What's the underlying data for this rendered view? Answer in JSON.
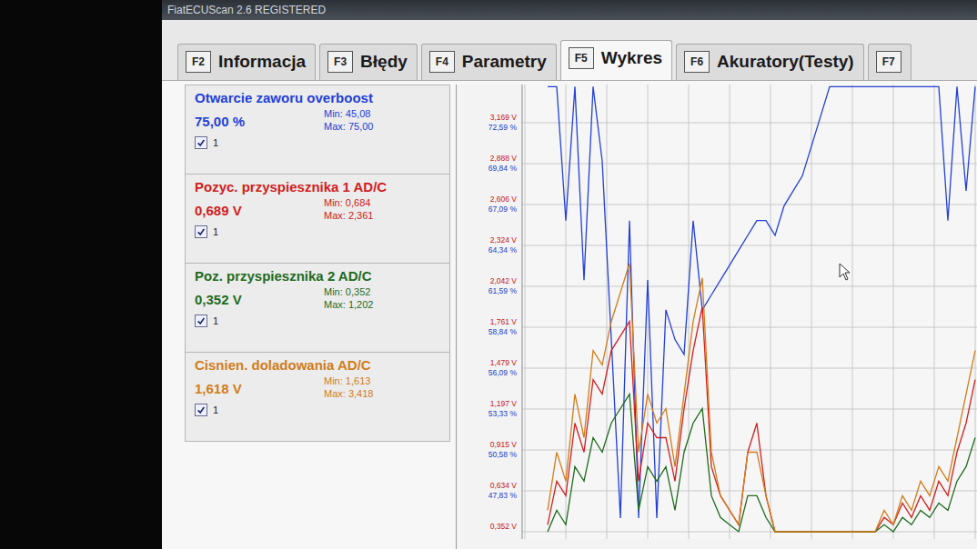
{
  "window": {
    "title": "FiatECUScan 2.6 REGISTERED"
  },
  "tabs": [
    {
      "key": "F2",
      "label": "Informacja",
      "selected": false
    },
    {
      "key": "F3",
      "label": "Błędy",
      "selected": false
    },
    {
      "key": "F4",
      "label": "Parametry",
      "selected": false
    },
    {
      "key": "F5",
      "label": "Wykres",
      "selected": true
    },
    {
      "key": "F6",
      "label": "Akuratory(Testy)",
      "selected": false
    },
    {
      "key": "F7",
      "label": "",
      "selected": false
    }
  ],
  "parameters": [
    {
      "name": "Otwarcie zaworu overboost",
      "value": "75,00 %",
      "min": "Min: 45,08",
      "max": "Max: 75,00",
      "checked": true,
      "channel": "1",
      "color": "#2340d8",
      "axis": "percent",
      "values": [
        75,
        75,
        66,
        75,
        62,
        75,
        70,
        58,
        46,
        66,
        46,
        62,
        46,
        60,
        58,
        57,
        66,
        60,
        61,
        62,
        63,
        64,
        65,
        66,
        66,
        65,
        67,
        68,
        69,
        71,
        73,
        75,
        75,
        75,
        75,
        75,
        75,
        75,
        75,
        75,
        75,
        75,
        75,
        75,
        66,
        75,
        68,
        75
      ]
    },
    {
      "name": "Pozyc. przyspiesznika 1 AD/C",
      "value": "0,689 V",
      "min": "Min: 0,684",
      "max": "Max: 2,361",
      "checked": true,
      "channel": "1",
      "color": "#d02020",
      "axis": "volts",
      "values": [
        0.4,
        0.7,
        0.6,
        1.1,
        0.9,
        1.4,
        1.3,
        1.6,
        1.7,
        1.8,
        0.7,
        1.1,
        1.0,
        1.0,
        0.7,
        1.2,
        1.6,
        1.9,
        0.8,
        0.6,
        0.5,
        0.4,
        0.9,
        1.1,
        0.6,
        0.352,
        0.352,
        0.352,
        0.352,
        0.352,
        0.352,
        0.352,
        0.352,
        0.352,
        0.352,
        0.352,
        0.352,
        0.45,
        0.4,
        0.55,
        0.45,
        0.6,
        0.5,
        0.7,
        0.6,
        0.9,
        1.1,
        1.4
      ]
    },
    {
      "name": "Poz. przyspiesznika 2 AD/C",
      "value": "0,352 V",
      "min": "Min: 0,352",
      "max": "Max: 1,202",
      "checked": true,
      "channel": "1",
      "color": "#1e6b1e",
      "axis": "volts",
      "values": [
        0.352,
        0.5,
        0.4,
        0.8,
        0.7,
        1.0,
        0.9,
        1.1,
        1.2,
        1.3,
        0.5,
        0.8,
        0.7,
        0.8,
        0.5,
        0.9,
        1.1,
        1.2,
        0.6,
        0.45,
        0.4,
        0.352,
        0.6,
        0.6,
        0.45,
        0.352,
        0.352,
        0.352,
        0.352,
        0.352,
        0.352,
        0.352,
        0.352,
        0.352,
        0.352,
        0.352,
        0.352,
        0.4,
        0.352,
        0.45,
        0.4,
        0.5,
        0.45,
        0.55,
        0.5,
        0.7,
        0.8,
        1.0
      ]
    },
    {
      "name": "Cisnien. doladowania AD/C",
      "value": "1,618 V",
      "min": "Min: 1,613",
      "max": "Max: 3,418",
      "checked": true,
      "channel": "1",
      "color": "#d07d1a",
      "axis": "volts",
      "values": [
        0.5,
        0.9,
        0.7,
        1.3,
        1.0,
        1.6,
        1.5,
        1.8,
        2.0,
        2.2,
        0.9,
        1.3,
        1.1,
        1.2,
        0.8,
        1.3,
        1.8,
        2.1,
        0.9,
        0.6,
        0.5,
        0.4,
        0.9,
        0.9,
        0.6,
        0.352,
        0.352,
        0.352,
        0.352,
        0.352,
        0.352,
        0.352,
        0.352,
        0.352,
        0.352,
        0.352,
        0.352,
        0.5,
        0.4,
        0.6,
        0.5,
        0.7,
        0.6,
        0.8,
        0.7,
        1.0,
        1.3,
        1.6
      ]
    }
  ],
  "chart": {
    "y_ticks": [
      {
        "volts": "3,169 V",
        "percent": "72,59 %"
      },
      {
        "volts": "2,888 V",
        "percent": "69,84 %"
      },
      {
        "volts": "2,606 V",
        "percent": "67,09 %"
      },
      {
        "volts": "2,324 V",
        "percent": "64,34 %"
      },
      {
        "volts": "2,042 V",
        "percent": "61,59 %"
      },
      {
        "volts": "1,761 V",
        "percent": "58,84 %"
      },
      {
        "volts": "1,479 V",
        "percent": "56,09 %"
      },
      {
        "volts": "1,197 V",
        "percent": "53,33 %"
      },
      {
        "volts": "0,915 V",
        "percent": "50,58 %"
      },
      {
        "volts": "0,634 V",
        "percent": "47,83 %"
      },
      {
        "volts": "0,352 V",
        "percent": ""
      }
    ]
  }
}
